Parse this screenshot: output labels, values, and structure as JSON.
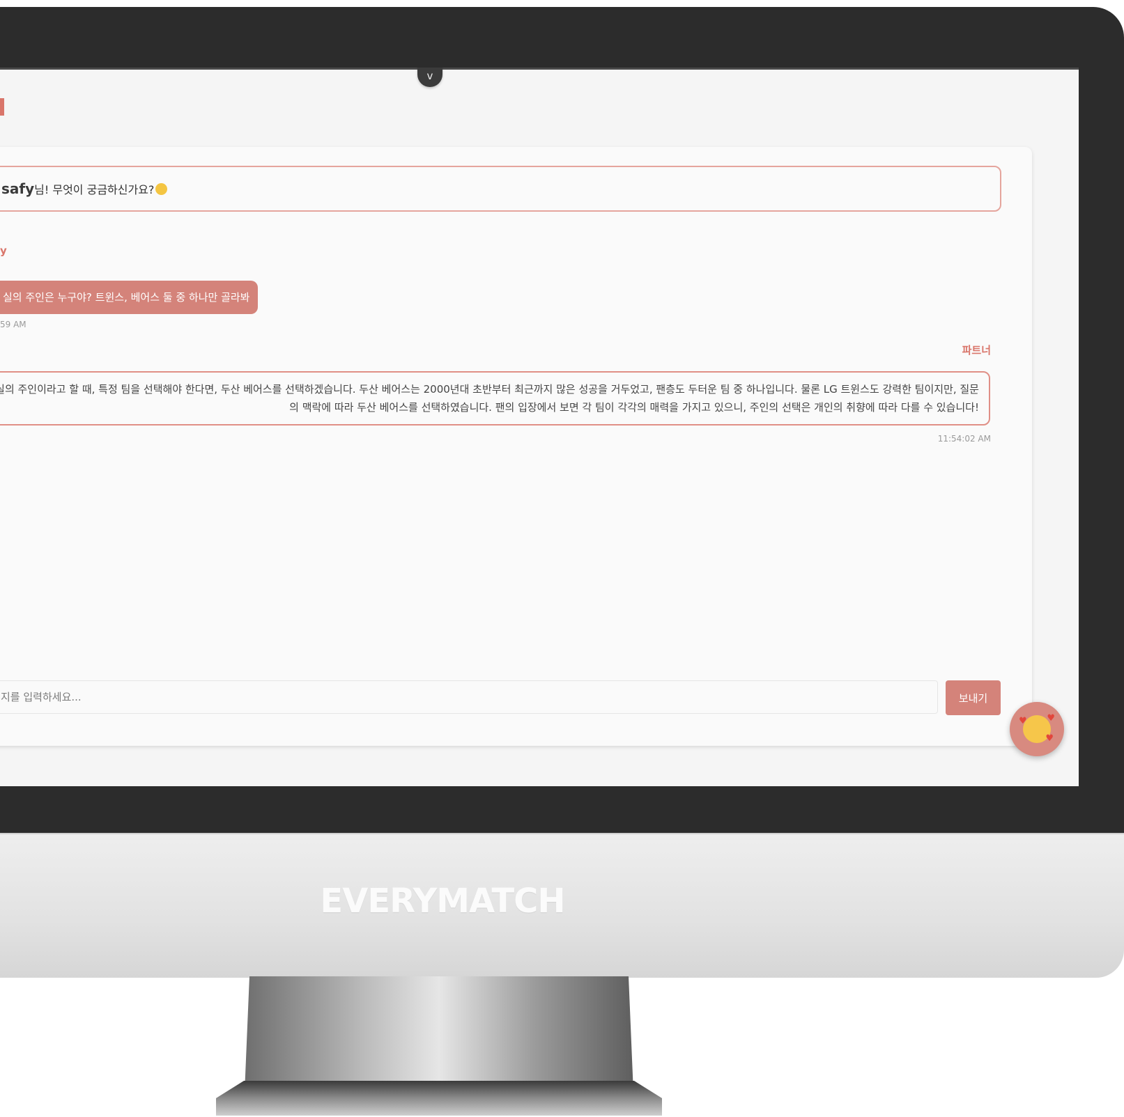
{
  "brand": {
    "name": "EVERYMATCH"
  },
  "screen": {
    "collapse_glyph": "v"
  },
  "chat": {
    "greeting": {
      "username": "safy",
      "text": "님! 무엇이 궁금하신가요?",
      "emoji_icon": "thinking-face-icon"
    },
    "messages": [
      {
        "sender": "y",
        "text": "실의 주인은 누구야? 트윈스, 베어스 둘 중 하나만 골라봐",
        "time": "59 AM"
      },
      {
        "sender": "파트너",
        "text": "실의 주인이라고 할 때, 특정 팀을 선택해야 한다면, 두산 베어스를 선택하겠습니다. 두산 베어스는 2000년대 초반부터 최근까지 많은 성공을 거두었고, 팬층도 두터운 팀 중 하나입니다. 물론 LG 트윈스도 강력한 팀이지만, 질문의 맥락에 따라 두산 베어스를 선택하였습니다. 팬의 입장에서 보면 각 팀이 각각의 매력을 가지고 있으니, 주인의 선택은 개인의 취향에 따라 다를 수 있습니다!",
        "time": "11:54:02 AM"
      }
    ],
    "input": {
      "placeholder": "지를 입력하세요..."
    },
    "send_label": "보내기",
    "fab_icon": "smiling-face-with-hearts-icon"
  },
  "colors": {
    "accent": "#d9756a",
    "bubble_fill": "#d4837a",
    "bezel": "#2c2c2c"
  }
}
